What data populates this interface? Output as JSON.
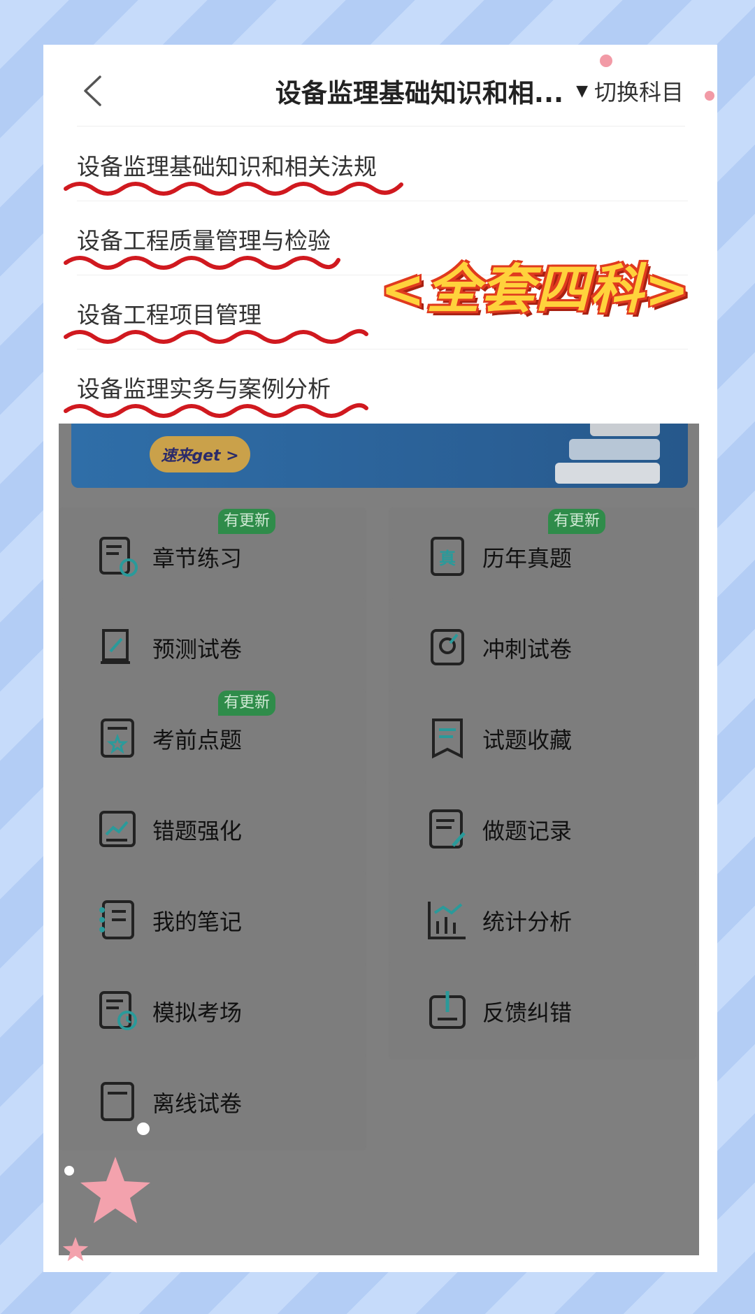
{
  "header": {
    "title": "设备监理基础知识和相...",
    "switch_label": "切换科目"
  },
  "subjects": [
    "设备监理基础知识和相关法规",
    "设备工程质量管理与检验",
    "设备工程项目管理",
    "设备监理实务与案例分析"
  ],
  "promo_text": "<全套四科>",
  "banner": {
    "button_label": "速来get >"
  },
  "tiles": [
    {
      "label": "章节练习",
      "icon": "chapter-practice-icon",
      "badge": "有更新"
    },
    {
      "label": "历年真题",
      "icon": "past-exam-icon",
      "badge": "有更新"
    },
    {
      "label": "预测试卷",
      "icon": "prediction-paper-icon",
      "badge": ""
    },
    {
      "label": "冲刺试卷",
      "icon": "sprint-paper-icon",
      "badge": ""
    },
    {
      "label": "考前点题",
      "icon": "pre-exam-tips-icon",
      "badge": "有更新"
    },
    {
      "label": "试题收藏",
      "icon": "favorites-icon",
      "badge": ""
    },
    {
      "label": "错题强化",
      "icon": "wrong-questions-icon",
      "badge": ""
    },
    {
      "label": "做题记录",
      "icon": "practice-record-icon",
      "badge": ""
    },
    {
      "label": "我的笔记",
      "icon": "notes-icon",
      "badge": ""
    },
    {
      "label": "统计分析",
      "icon": "statistics-icon",
      "badge": ""
    },
    {
      "label": "模拟考场",
      "icon": "mock-exam-icon",
      "badge": ""
    },
    {
      "label": "反馈纠错",
      "icon": "feedback-icon",
      "badge": ""
    },
    {
      "label": "离线试卷",
      "icon": "offline-paper-icon",
      "badge": ""
    }
  ],
  "colors": {
    "underline_red": "#d0191f",
    "badge_green": "#2f8c4a",
    "overlay_grey": "#7f7f7f",
    "banner_blue": "#2f6ea8"
  }
}
